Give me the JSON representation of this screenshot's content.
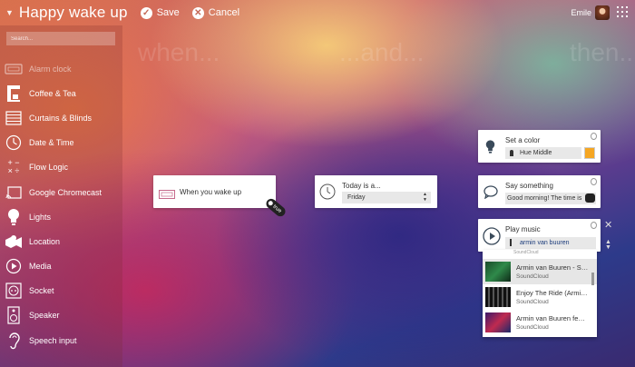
{
  "app": {
    "title": "Happy wake up",
    "save_label": "Save",
    "cancel_label": "Cancel",
    "user_name": "Emile"
  },
  "search": {
    "placeholder": "Search..."
  },
  "sidebar": {
    "items": [
      {
        "label": "Alarm clock",
        "icon": "alarm-clock-icon"
      },
      {
        "label": "Coffee & Tea",
        "icon": "coffee-machine-icon"
      },
      {
        "label": "Curtains & Blinds",
        "icon": "blinds-icon"
      },
      {
        "label": "Date & Time",
        "icon": "clock-icon"
      },
      {
        "label": "Flow Logic",
        "icon": "plus-minus-times-icon"
      },
      {
        "label": "Google Chromecast",
        "icon": "cast-icon"
      },
      {
        "label": "Lights",
        "icon": "bulb-icon"
      },
      {
        "label": "Location",
        "icon": "map-icon"
      },
      {
        "label": "Media",
        "icon": "play-icon"
      },
      {
        "label": "Socket",
        "icon": "socket-icon"
      },
      {
        "label": "Speaker",
        "icon": "speaker-icon"
      },
      {
        "label": "Speech input",
        "icon": "ear-icon"
      }
    ]
  },
  "columns": {
    "when": "when...",
    "and": "...and...",
    "then": "then..."
  },
  "when_card": {
    "label": "When you wake up",
    "tag": "true"
  },
  "and_card": {
    "label": "Today is a...",
    "value": "Friday"
  },
  "then_cards": {
    "color": {
      "label": "Set a color",
      "value": "Hue Middle",
      "swatch": "#f5a623"
    },
    "say": {
      "label": "Say something",
      "value": "Good morning! The time is"
    },
    "music": {
      "label": "Play music",
      "value": "armin van buuren"
    }
  },
  "dropdown": {
    "partial_top": "SoundCloud",
    "results": [
      {
        "title": "Armin van Buuren - Sa...",
        "source": "SoundCloud",
        "highlighted": true
      },
      {
        "title": "Enjoy The Ride (Armin...",
        "source": "SoundCloud",
        "highlighted": false
      },
      {
        "title": "Armin van Buuren feat...",
        "source": "SoundCloud",
        "highlighted": false
      }
    ]
  },
  "colors": {
    "accent_orange": "#f5a623"
  }
}
